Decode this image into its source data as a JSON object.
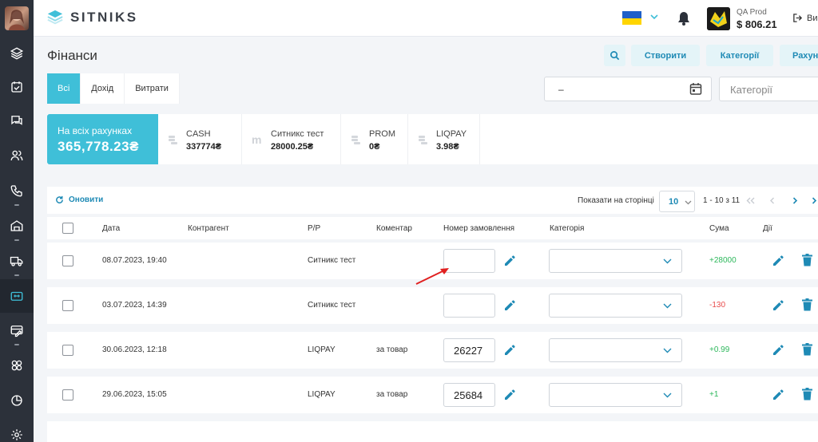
{
  "app": {
    "logo_text": "SITNIKS",
    "page_title": "Фінанси"
  },
  "header": {
    "account_name": "QA Prod",
    "account_balance": "$ 806.21",
    "logout_label": "Ви"
  },
  "actions": {
    "create": "Створити",
    "categories": "Категорії",
    "accounts": "Рахун"
  },
  "tabs": [
    "Всі",
    "Дохід",
    "Витрати"
  ],
  "filters": {
    "date_value": "–",
    "category_placeholder": "Категорії"
  },
  "balances": {
    "total_label": "На всіх рахунках",
    "total_value": "365,778.23₴",
    "accounts": [
      {
        "icon": "coins-icon",
        "name": "CASH",
        "amount": "337774₴"
      },
      {
        "icon": "m-logo-icon",
        "name": "Ситникс тест",
        "amount": "28000.25₴"
      },
      {
        "icon": "coins-icon",
        "name": "PROM",
        "amount": "0₴"
      },
      {
        "icon": "coins-icon",
        "name": "LIQPAY",
        "amount": "3.98₴"
      }
    ]
  },
  "toolbar": {
    "refresh": "Оновити",
    "per_page_label": "Показати на сторінці",
    "per_page_value": "10",
    "range": "1 - 10 з 11"
  },
  "columns": [
    "Дата",
    "Контрагент",
    "Р/Р",
    "Коментар",
    "Номер замовлення",
    "Категорія",
    "Сума",
    "Дії"
  ],
  "rows": [
    {
      "date": "08.07.2023, 19:40",
      "counterparty": "",
      "account": "Ситникс тест",
      "comment": "",
      "order": "",
      "amount": "+28000",
      "sign": "pos"
    },
    {
      "date": "03.07.2023, 14:39",
      "counterparty": "",
      "account": "Ситникс тест",
      "comment": "",
      "order": "",
      "amount": "-130",
      "sign": "neg"
    },
    {
      "date": "30.06.2023, 12:18",
      "counterparty": "",
      "account": "LIQPAY",
      "comment": "за товар",
      "order": "26227",
      "amount": "+0.99",
      "sign": "pos"
    },
    {
      "date": "29.06.2023, 15:05",
      "counterparty": "",
      "account": "LIQPAY",
      "comment": "за товар",
      "order": "25684",
      "amount": "+1",
      "sign": "pos"
    }
  ],
  "colors": {
    "accent": "#3fbfd8",
    "link": "#1e8ab5",
    "positive": "#2eb85c",
    "negative": "#e84b4b",
    "sidebar": "#2c313a"
  }
}
